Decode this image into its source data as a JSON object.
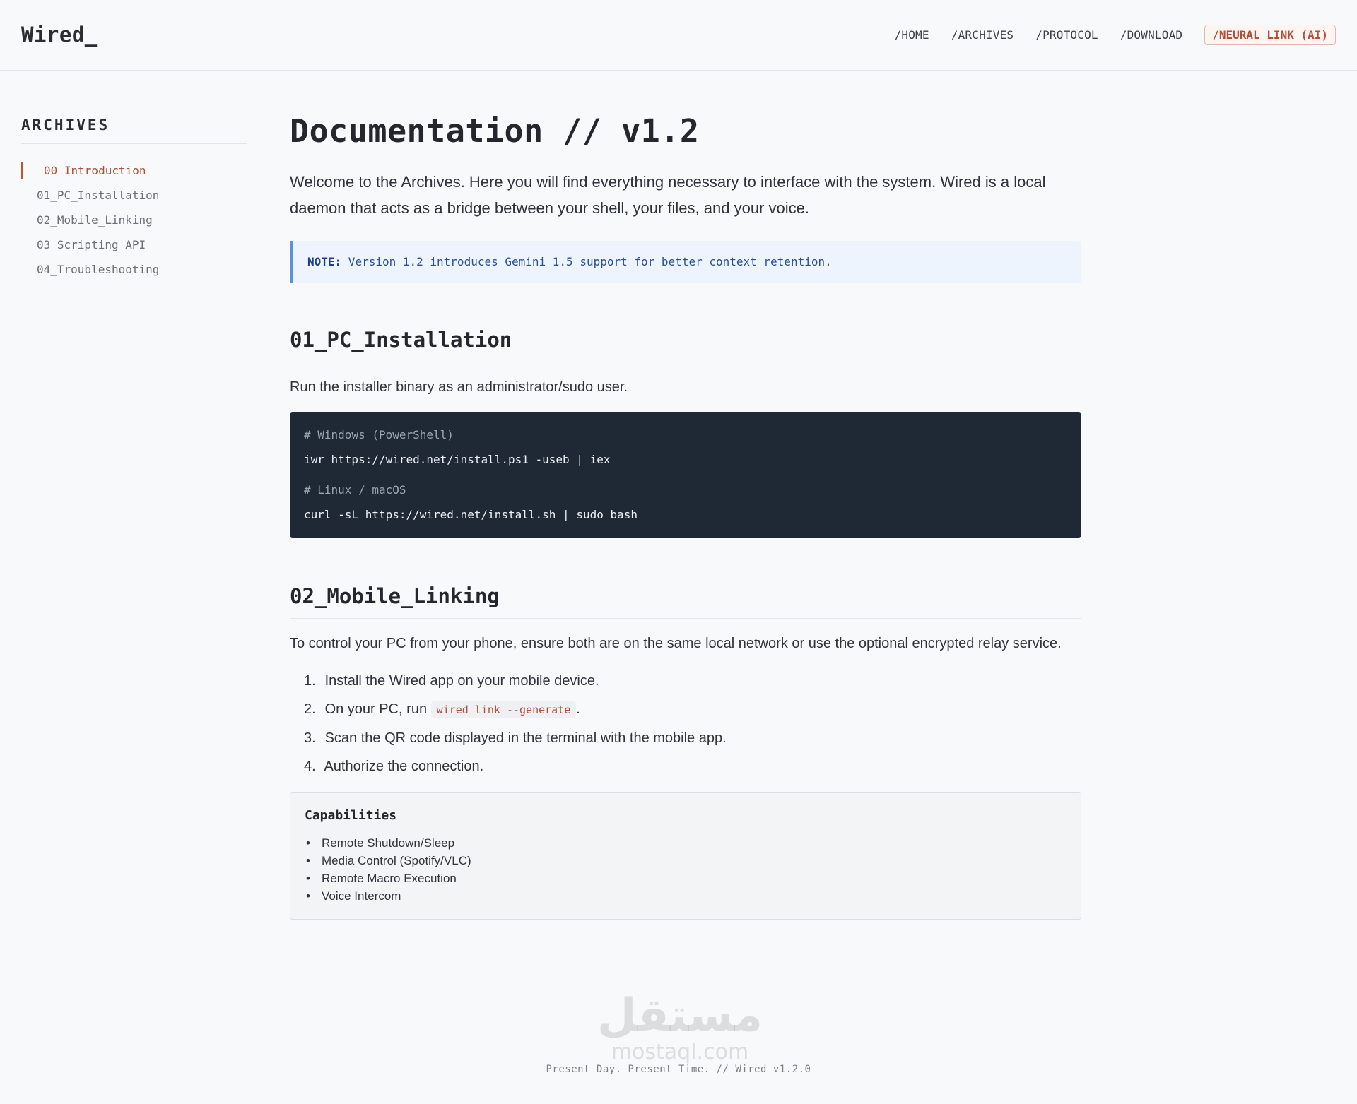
{
  "header": {
    "logo": "Wired_",
    "nav": [
      "/HOME",
      "/ARCHIVES",
      "/PROTOCOL",
      "/DOWNLOAD"
    ],
    "nav_ai": "/NEURAL LINK (AI)"
  },
  "sidebar": {
    "title": "ARCHIVES",
    "items": [
      "00_Introduction",
      "01_PC_Installation",
      "02_Mobile_Linking",
      "03_Scripting_API",
      "04_Troubleshooting"
    ],
    "active_index": 0
  },
  "main": {
    "title": "Documentation // v1.2",
    "intro": "Welcome to the Archives. Here you will find everything necessary to interface with the system. Wired is a local daemon that acts as a bridge between your shell, your files, and your voice.",
    "note_label": "NOTE:",
    "note_text": " Version 1.2 introduces Gemini 1.5 support for better context retention.",
    "section1": {
      "heading": "01_PC_Installation",
      "text": "Run the installer binary as an administrator/sudo user.",
      "code": {
        "comment1": "# Windows (PowerShell)",
        "cmd1": "iwr https://wired.net/install.ps1 -useb | iex",
        "comment2": "# Linux / macOS",
        "cmd2": "curl -sL https://wired.net/install.sh | sudo bash"
      }
    },
    "section2": {
      "heading": "02_Mobile_Linking",
      "text": "To control your PC from your phone, ensure both are on the same local network or use the optional encrypted relay service.",
      "steps": {
        "s1": "Install the Wired app on your mobile device.",
        "s2_pre": "On your PC, run ",
        "s2_code": "wired link --generate",
        "s2_post": ".",
        "s3": "Scan the QR code displayed in the terminal with the mobile app.",
        "s4": "Authorize the connection."
      },
      "capabilities": {
        "title": "Capabilities",
        "items": [
          "Remote Shutdown/Sleep",
          "Media Control (Spotify/VLC)",
          "Remote Macro Execution",
          "Voice Intercom"
        ]
      }
    }
  },
  "footer": {
    "text": "Present Day. Present Time. // Wired v1.2.0"
  },
  "watermark": {
    "line1": "مستقل",
    "line2": "mostaql.com"
  },
  "colors": {
    "accent": "#b24f35",
    "note_border": "#5b93d8",
    "code_bg": "#1f2835",
    "background": "#f8f9fb"
  }
}
